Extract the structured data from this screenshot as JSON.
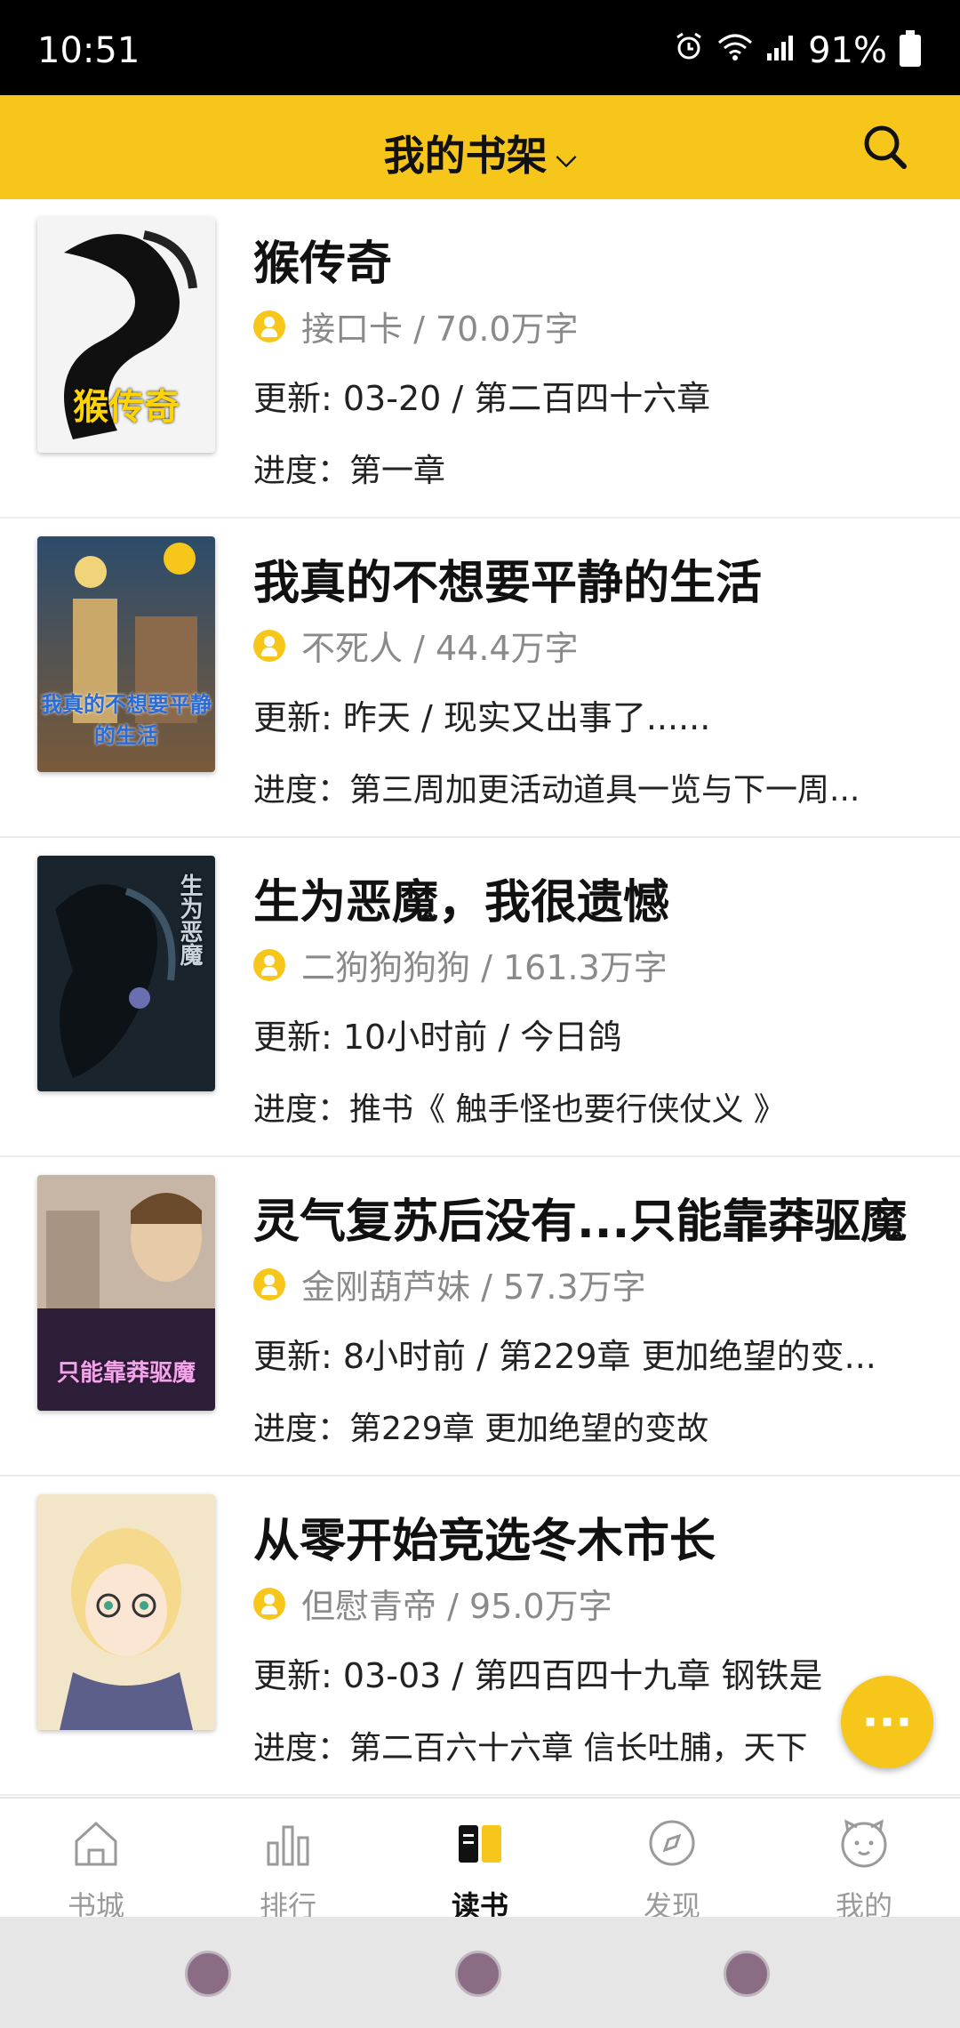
{
  "status": {
    "time": "10:51",
    "battery": "91%"
  },
  "header": {
    "title": "我的书架",
    "chevron": "⌵"
  },
  "books": [
    {
      "title": "猴传奇",
      "author": "接口卡 / 70.0万字",
      "update": "更新: 03-20 / 第二百四十六章",
      "progress": "进度：第一章",
      "cover_text": "猴传奇",
      "cover_colors": [
        "#f4f4f4",
        "#101010"
      ]
    },
    {
      "title": "我真的不想要平静的生活",
      "author": "不死人 / 44.4万字",
      "update": "更新: 昨天 / 现实又出事了......",
      "progress": "进度：第三周加更活动道具一览与下一周...",
      "cover_text": "我真的不想要平静的生活",
      "cover_colors": [
        "#f1d37a",
        "#2c4c6b"
      ]
    },
    {
      "title": "生为恶魔，我很遗憾",
      "author": "二狗狗狗狗 / 161.3万字",
      "update": "更新: 10小时前 / 今日鸽",
      "progress": "进度：推书《 触手怪也要行侠仗义 》",
      "cover_text": "生为恶魔",
      "cover_colors": [
        "#2b3b4a",
        "#0d1216"
      ]
    },
    {
      "title": "灵气复苏后没有...只能靠莽驱魔",
      "author": "金刚葫芦妹 / 57.3万字",
      "update": "更新: 8小时前 / 第229章 更加绝望的变...",
      "progress": "进度：第229章 更加绝望的变故",
      "cover_text": "只能靠莽驱魔",
      "cover_colors": [
        "#c7b6a6",
        "#2d1f38"
      ]
    },
    {
      "title": "从零开始竞选冬木市长",
      "author": "但慰青帝 / 95.0万字",
      "update": "更新: 03-03 / 第四百四十九章 钢铁是",
      "progress": "进度：第二百六十六章 信长吐脯，天下",
      "cover_text": "",
      "cover_colors": [
        "#f3e6c8",
        "#5b5f8a"
      ]
    }
  ],
  "fab": {
    "label": "···"
  },
  "tabs": [
    {
      "label": "书城",
      "icon": "house-icon"
    },
    {
      "label": "排行",
      "icon": "bar-chart-icon"
    },
    {
      "label": "读书",
      "icon": "book-icon",
      "active": true
    },
    {
      "label": "发现",
      "icon": "compass-icon"
    },
    {
      "label": "我的",
      "icon": "cat-face-icon"
    }
  ],
  "colors": {
    "accent": "#f6c61b"
  }
}
